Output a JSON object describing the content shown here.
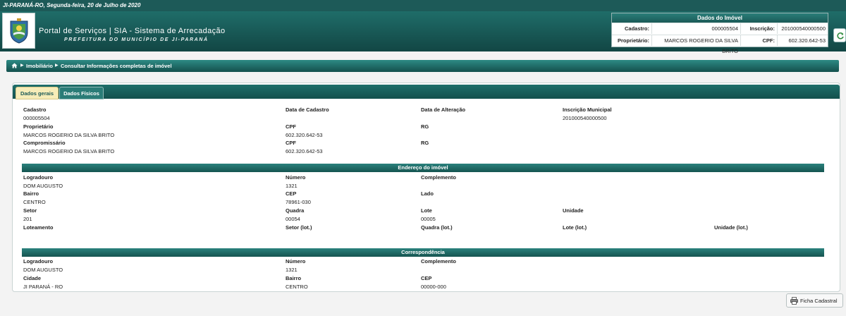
{
  "topbar": {
    "date_text": "JI-PARANÁ-RO, Segunda-feira, 20 de Julho de 2020"
  },
  "header": {
    "title": "Portal de Serviços | SIA - Sistema de Arrecadação",
    "subtitle": "PREFEITURA DO MUNICÍPIO DE JI-PARANÁ",
    "logo_icon": "municipal-crest-icon"
  },
  "imovel_box": {
    "heading": "Dados do Imóvel",
    "cadastro_label": "Cadastro:",
    "cadastro_value": "000005504",
    "inscricao_label": "Inscrição:",
    "inscricao_value": "201000540000500",
    "proprietario_label": "Proprietário:",
    "proprietario_value": "MARCOS ROGERIO DA SILVA BRITO",
    "cpf_label": "CPF:",
    "cpf_value": "602.320.642-53",
    "refresh_icon": "refresh-icon"
  },
  "breadcrumb": {
    "items": [
      "Imobiliário",
      "Consultar Informações completas de imóvel"
    ],
    "home_icon": "home-icon"
  },
  "tabs": [
    {
      "label": "Dados gerais",
      "active": true
    },
    {
      "label": "Dados Físicos",
      "active": false
    }
  ],
  "geral": {
    "cadastro_label": "Cadastro",
    "cadastro_value": "000005504",
    "data_cadastro_label": "Data de Cadastro",
    "data_cadastro_value": "",
    "data_alteracao_label": "Data de Alteração",
    "data_alteracao_value": "",
    "inscricao_label": "Inscrição Municipal",
    "inscricao_value": "201000540000500",
    "proprietario_label": "Proprietário",
    "proprietario_value": "MARCOS ROGERIO DA SILVA BRITO",
    "cpf_label": "CPF",
    "cpf_value": "602.320.642-53",
    "rg_label": "RG",
    "rg_value": "",
    "compromissario_label": "Compromissário",
    "compromissario_value": "MARCOS ROGERIO DA SILVA BRITO",
    "cpf2_label": "CPF",
    "cpf2_value": "602.320.642-53",
    "rg2_label": "RG",
    "rg2_value": ""
  },
  "endereco": {
    "section_title": "Endereço do imóvel",
    "logradouro_label": "Logradouro",
    "logradouro_value": "DOM AUGUSTO",
    "numero_label": "Número",
    "numero_value": "1321",
    "complemento_label": "Complemento",
    "complemento_value": "",
    "bairro_label": "Bairro",
    "bairro_value": "CENTRO",
    "cep_label": "CEP",
    "cep_value": "78961-030",
    "lado_label": "Lado",
    "lado_value": "",
    "setor_label": "Setor",
    "setor_value": "201",
    "quadra_label": "Quadra",
    "quadra_value": "00054",
    "lote_label": "Lote",
    "lote_value": "00005",
    "unidade_label": "Unidade",
    "unidade_value": "",
    "loteamento_label": "Loteamento",
    "setor_lot_label": "Setor (lot.)",
    "quadra_lot_label": "Quadra (lot.)",
    "lote_lot_label": "Lote (lot.)",
    "unidade_lot_label": "Unidade (lot.)"
  },
  "correspondencia": {
    "section_title": "Correspondência",
    "logradouro_label": "Logradouro",
    "logradouro_value": "DOM AUGUSTO",
    "numero_label": "Número",
    "numero_value": "1321",
    "complemento_label": "Complemento",
    "complemento_value": "",
    "cidade_label": "Cidade",
    "cidade_value": "JI PARANÁ - RO",
    "bairro_label": "Bairro",
    "bairro_value": "CENTRO",
    "cep_label": "CEP",
    "cep_value": "00000-000"
  },
  "actions": {
    "ficha_label": "Ficha Cadastral",
    "printer_icon": "printer-icon"
  }
}
